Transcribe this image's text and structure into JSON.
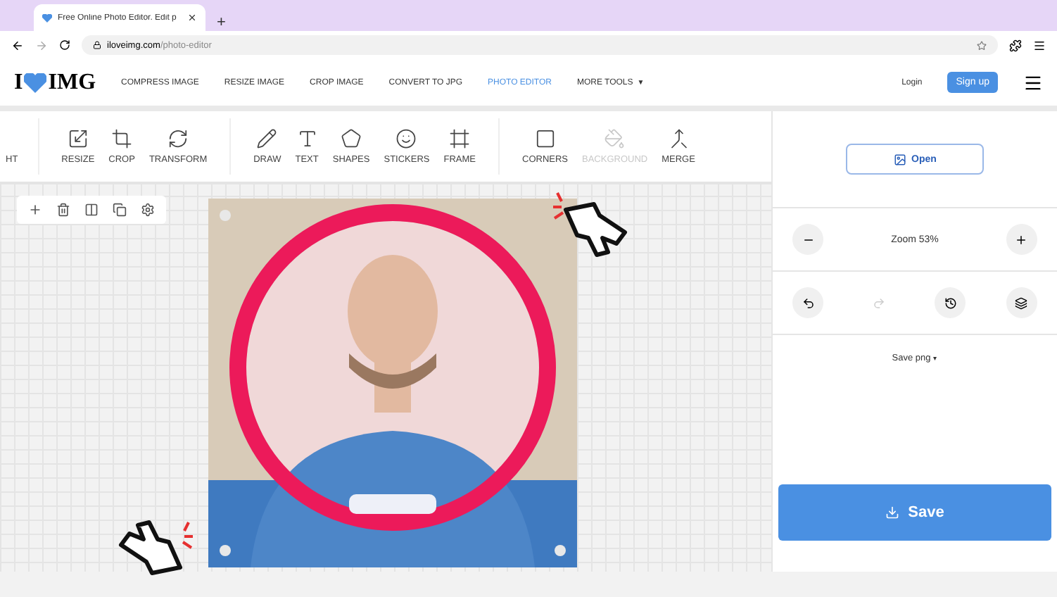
{
  "browser": {
    "tab_title": "Free Online Photo Editor. Edit p",
    "new_tab": "+",
    "url_host": "iloveimg.com",
    "url_path": "/photo-editor"
  },
  "site": {
    "logo_left": "I",
    "logo_right": "IMG",
    "nav": [
      {
        "label": "COMPRESS IMAGE",
        "selected": false
      },
      {
        "label": "RESIZE IMAGE",
        "selected": false
      },
      {
        "label": "CROP IMAGE",
        "selected": false
      },
      {
        "label": "CONVERT TO JPG",
        "selected": false
      },
      {
        "label": "PHOTO EDITOR",
        "selected": true
      },
      {
        "label": "MORE TOOLS",
        "selected": false,
        "caret": "▼"
      }
    ],
    "login": "Login",
    "signup": "Sign up"
  },
  "tools": [
    {
      "label": "HT",
      "disabled": false
    },
    {
      "label": "RESIZE",
      "disabled": false
    },
    {
      "label": "CROP",
      "disabled": false
    },
    {
      "label": "TRANSFORM",
      "disabled": false
    },
    {
      "label": "DRAW",
      "disabled": false
    },
    {
      "label": "TEXT",
      "disabled": false
    },
    {
      "label": "SHAPES",
      "disabled": false
    },
    {
      "label": "STICKERS",
      "disabled": false
    },
    {
      "label": "FRAME",
      "disabled": false
    },
    {
      "label": "CORNERS",
      "disabled": false
    },
    {
      "label": "BACKGROUND",
      "disabled": true
    },
    {
      "label": "MERGE",
      "disabled": false
    }
  ],
  "panel": {
    "open": "Open",
    "zoom": "Zoom  53%",
    "save_format": "Save png",
    "save_format_caret": "▾",
    "save": "Save"
  }
}
